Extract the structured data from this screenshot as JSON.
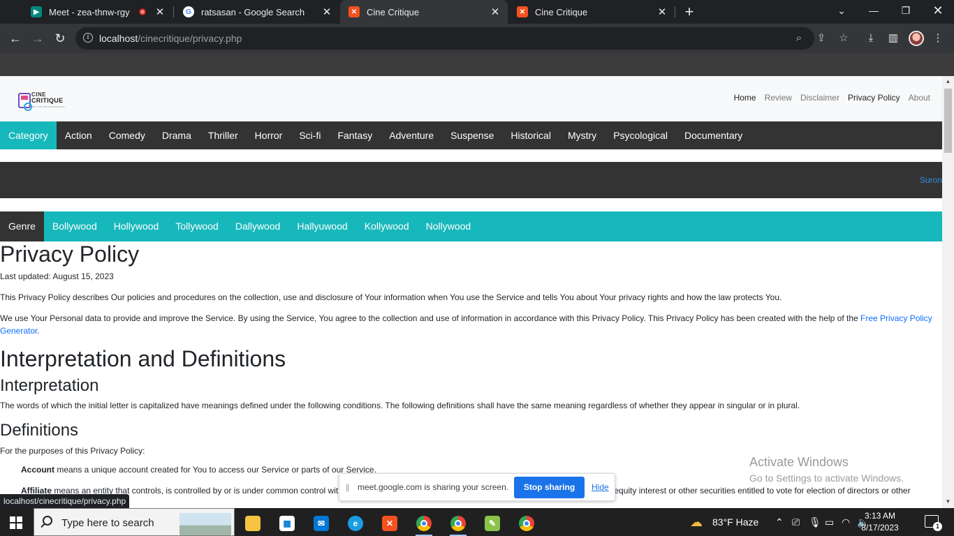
{
  "browser": {
    "tabs": [
      {
        "title": "Meet - zea-thnw-rgy"
      },
      {
        "title": "ratsasan - Google Search"
      },
      {
        "title": "Cine Critique"
      },
      {
        "title": "Cine Critique"
      }
    ],
    "url_host": "localhost",
    "url_path": "/cinecritique/privacy.php",
    "status_url": "localhost/cinecritique/privacy.php"
  },
  "site": {
    "logo_line1": "CINE",
    "logo_line2": "CRITIQUE",
    "logo_tagline": "BEST SITE FOR MOVIE REVIEWS",
    "topnav": [
      "Home",
      "Review",
      "Disclaimer",
      "Privacy Policy",
      "About"
    ],
    "categories": [
      "Category",
      "Action",
      "Comedy",
      "Drama",
      "Thriller",
      "Horror",
      "Sci-fi",
      "Fantasy",
      "Adventure",
      "Suspense",
      "Historical",
      "Mystry",
      "Psycological",
      "Documentary"
    ],
    "marquee_text": "Suron",
    "genres": [
      "Genre",
      "Bollywood",
      "Hollywood",
      "Tollywood",
      "Dallywood",
      "Hallyuwood",
      "Kollywood",
      "Nollywood"
    ]
  },
  "content": {
    "title": "Privacy Policy",
    "last_updated": "Last updated: August 15, 2023",
    "p1": "This Privacy Policy describes Our policies and procedures on the collection, use and disclosure of Your information when You use the Service and tells You about Your privacy rights and how the law protects You.",
    "p2": "We use Your Personal data to provide and improve the Service. By using the Service, You agree to the collection and use of information in accordance with this Privacy Policy. This Privacy Policy has been created with the help of the ",
    "p2_link": "Free Privacy Policy Generator",
    "p2_end": ".",
    "h2": "Interpretation and Definitions",
    "h3a": "Interpretation",
    "p3": "The words of which the initial letter is capitalized have meanings defined under the following conditions. The following definitions shall have the same meaning regardless of whether they appear in singular or in plural.",
    "h3b": "Definitions",
    "p4": "For the purposes of this Privacy Policy:",
    "def1_term": "Account",
    "def1_text": " means a unique account created for You to access our Service or parts of our Service.",
    "def2_term": "Affiliate",
    "def2_text": " means an entity that controls, is controlled by or is under common control with a party, where \"control\" means ownership of 50% or more of the shares, equity interest or other securities entitled to vote for election of directors or other"
  },
  "share_bar": {
    "message": "meet.google.com is sharing your screen.",
    "stop_label": "Stop sharing",
    "hide_label": "Hide"
  },
  "activate": {
    "line1": "Activate Windows",
    "line2": "Go to Settings to activate Windows."
  },
  "taskbar": {
    "search_placeholder": "Type here to search",
    "weather": "83°F  Haze",
    "time": "3:13 AM",
    "date": "8/17/2023",
    "notif_count": "1"
  },
  "colors": {
    "accent_teal": "#17b8bc",
    "dark_bar": "#333333",
    "link_blue": "#0d6efd"
  }
}
